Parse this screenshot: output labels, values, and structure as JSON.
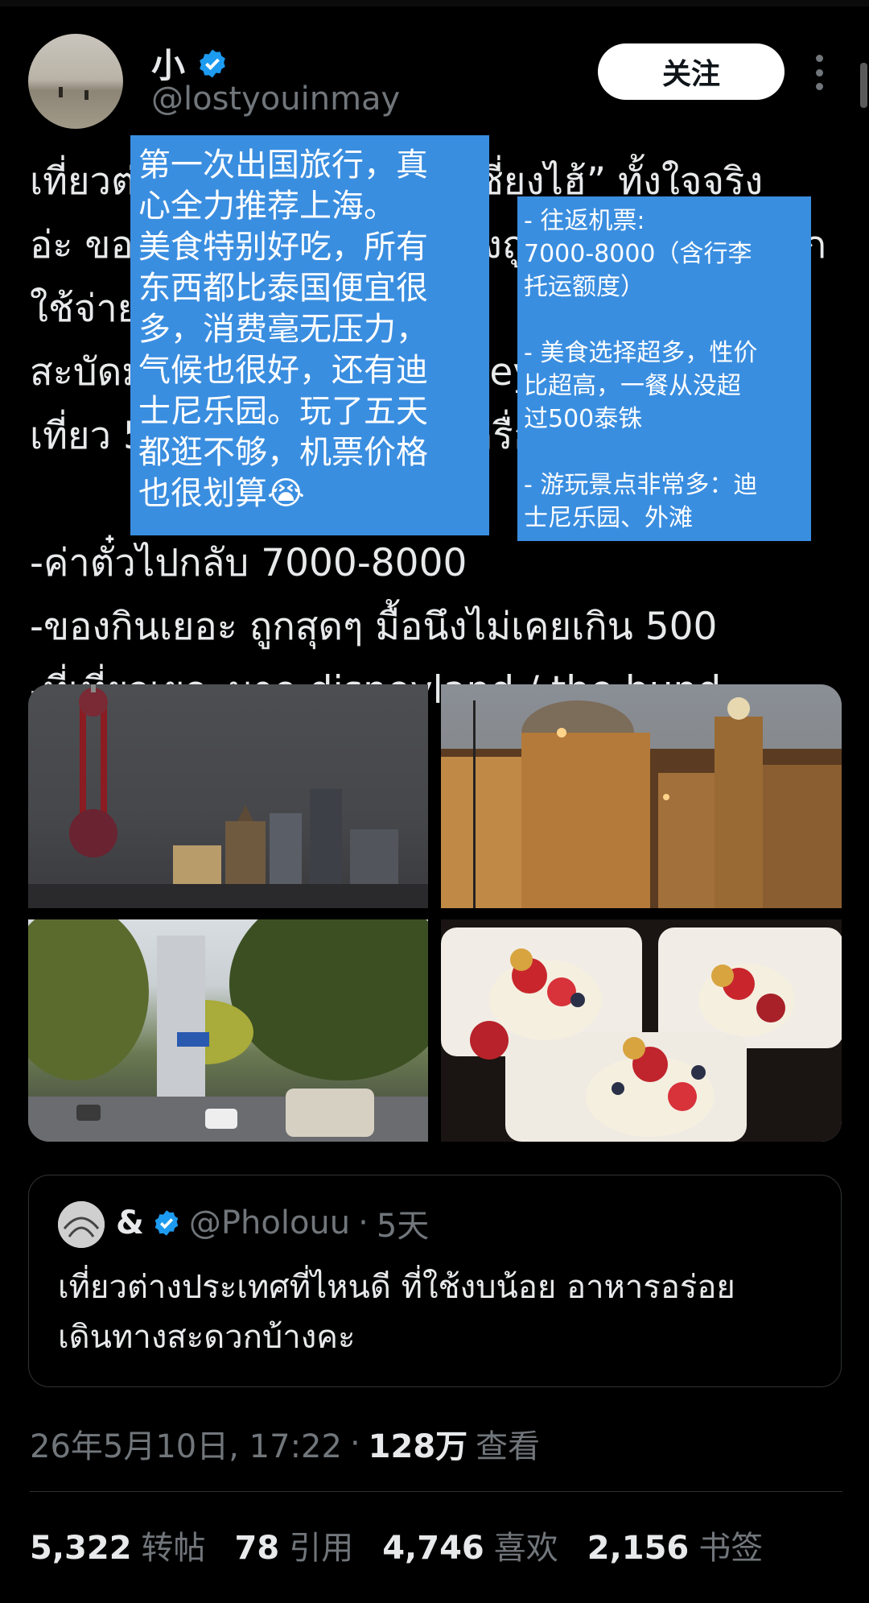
{
  "author": {
    "name": "小",
    "handle": "@lostyouinmay",
    "follow_label": "关注"
  },
  "tweet": {
    "text": "เที่ยวต่างประเทศครั้งแรก “เซี่ยงไฮ้” ทั้งใจจริง\nอ่ะ ของกินอร่อยมาก ทุกอย่างถูกกว่าไทยเยอะมาก ใช้จ่าย\nสะบัดมาก อากาศก็ดี มี disneyland ด้วย\nเที่ยว 5 วันยังไม่พอเลย ตั๋วเครื่องบินก็คุ้ม\n\n-ค่าตั๋วไปกลับ 7000-8000\n-ของกินเยอะ ถูกสุดๆ มื้อนึงไม่เคยเกิน 500\n-ที่เที่ยวเยอะมาก disneyland / the bund"
  },
  "overlays": {
    "left": "第一次出国旅行，真\n心全力推荐上海。\n美食特别好吃，所有\n东西都比泰国便宜很\n多，消费毫无压力，\n气候也很好，还有迪\n士尼乐园。玩了五天\n都逛不够，机票价格\n也很划算😭",
    "right": "- 往返机票:\n7000-8000（含行李\n托运额度）\n\n- 美食选择超多，性价\n比超高，一餐从没超\n过500泰铢\n\n- 游玩景点非常多：迪\n士尼乐园、外滩"
  },
  "quoted": {
    "name": "&",
    "handle": "@Pholouu",
    "separator": "·",
    "time": "5天",
    "text": "เที่ยวต่างประเทศที่ไหนดี ที่ใช้งบน้อย อาหารอร่อย\nเดินทางสะดวกบ้างคะ"
  },
  "meta": {
    "datetime": "26年5月10日, 17:22",
    "separator": "·",
    "views_count": "128万",
    "views_label": "查看"
  },
  "stats": [
    {
      "count": "5,322",
      "label": "转帖"
    },
    {
      "count": "78",
      "label": "引用"
    },
    {
      "count": "4,746",
      "label": "喜欢"
    },
    {
      "count": "2,156",
      "label": "书签"
    }
  ],
  "colors": {
    "background": "#000000",
    "overlay_blue": "#3a8ee0",
    "verified_blue": "#1d9bf0",
    "muted_text": "#71767b"
  },
  "icons": [
    "verified-badge-icon",
    "more-options-icon"
  ]
}
